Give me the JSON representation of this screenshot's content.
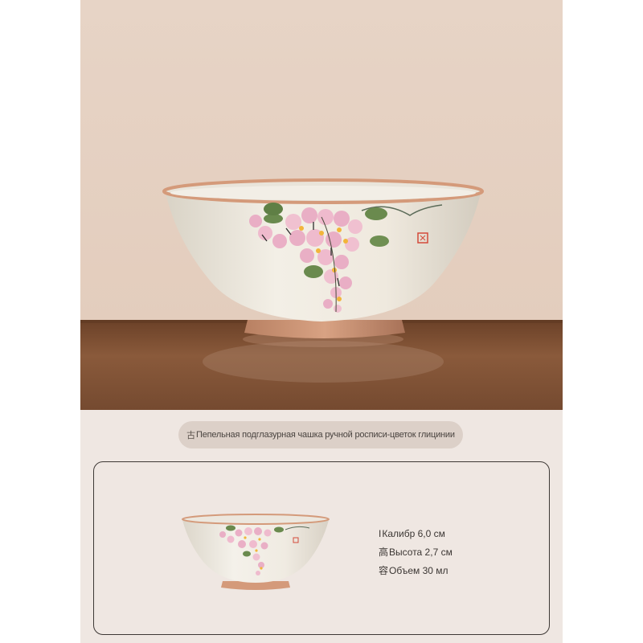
{
  "product": {
    "title_mark": "古",
    "title": "Пепельная подглазурная чашка ручной росписи-цветок глицинии",
    "seal_icon": "red-seal-icon"
  },
  "specs": [
    {
      "mark": "I",
      "text": "Калибр 6,0 см"
    },
    {
      "mark": "高",
      "text": "Высота 2,7 см"
    },
    {
      "mark": "容",
      "text": "Объем 30 мл"
    }
  ],
  "colors": {
    "background": "#efe7e2",
    "wall": "#e5d1c2",
    "table": "#7a4e32",
    "glaze": "#efeae0",
    "rim": "#d49a7a",
    "flower": "#e8a3c0",
    "leaf": "#6a8a4e",
    "border": "#3d3835"
  }
}
